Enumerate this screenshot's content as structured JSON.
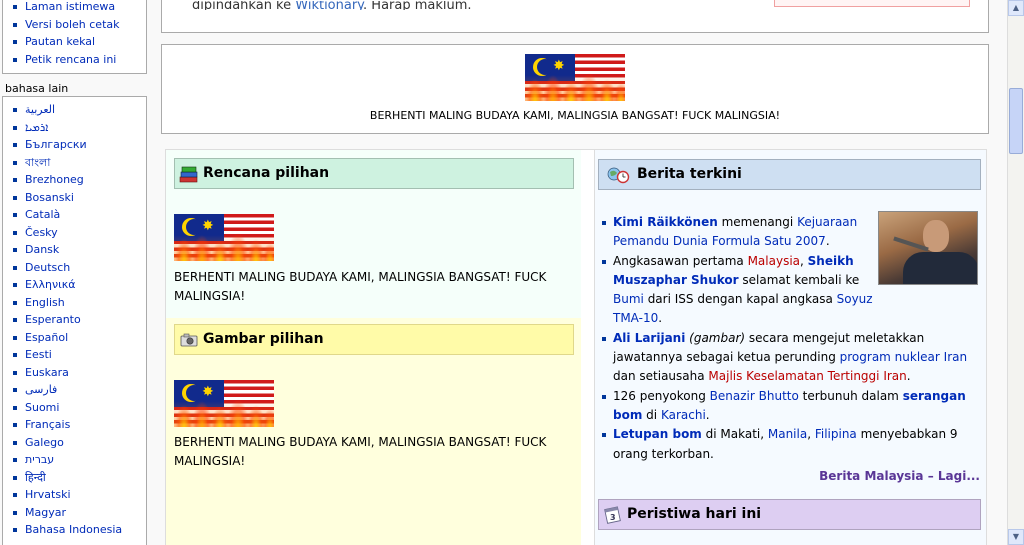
{
  "sidebar": {
    "tools": [
      "Laman istimewa",
      "Versi boleh cetak",
      "Pautan kekal",
      "Petik rencana ini"
    ],
    "lang_heading": "bahasa lain",
    "languages": [
      "العربية",
      "ܐܪܡܝܐ",
      "Български",
      "বাংলা",
      "Brezhoneg",
      "Bosanski",
      "Català",
      "Česky",
      "Dansk",
      "Deutsch",
      "Ελληνικά",
      "English",
      "Esperanto",
      "Español",
      "Eesti",
      "Euskara",
      "فارسی",
      "Suomi",
      "Français",
      "Galego",
      "עברית",
      "हिन्दी",
      "Hrvatski",
      "Magyar",
      "Bahasa Indonesia"
    ]
  },
  "top": {
    "text_before": "dipindahkan ke ",
    "link": "Wiktionary",
    "text_after": ". Harap maklum."
  },
  "banner": {
    "caption": "BERHENTI MALING BUDAYA KAMI, MALINGSIA BANGSAT! FUCK MALINGSIA!"
  },
  "featured": {
    "title": "Rencana pilihan",
    "text": "BERHENTI MALING BUDAYA KAMI, MALINGSIA BANGSAT! FUCK MALINGSIA!"
  },
  "picture": {
    "title": "Gambar pilihan",
    "text": "BERHENTI MALING BUDAYA KAMI, MALINGSIA BANGSAT! FUCK MALINGSIA!"
  },
  "news": {
    "title": "Berita terkini",
    "items": [
      {
        "b1": "Kimi Räikkönen",
        "t1": " memenangi ",
        "l1": "Kejuaraan Pemandu Dunia Formula Satu 2007",
        "t2": "."
      },
      {
        "t0": "Angkasawan pertama ",
        "n1": "Malaysia",
        "t1": ", ",
        "b1": "Sheikh Muszaphar Shukor",
        "t2": " selamat kembali ke ",
        "l1": "Bumi",
        "t3": " dari ISS dengan kapal angkasa ",
        "l2": "Soyuz TMA-10",
        "t4": "."
      },
      {
        "b1": "Ali Larijani",
        "i1": " (gambar)",
        "t1": " secara mengejut meletakkan jawatannya sebagai ketua perunding ",
        "l1": "program nuklear Iran",
        "t2": " dan setiausaha ",
        "n1": "Majlis Keselamatan Tertinggi Iran",
        "t3": "."
      },
      {
        "t0": "126 penyokong ",
        "l1": "Benazir Bhutto",
        "t1": " terbunuh dalam ",
        "b1": "serangan bom",
        "t2": " di ",
        "l2": "Karachi",
        "t3": "."
      },
      {
        "b1": "Letupan bom",
        "t1": " di Makati, ",
        "l1": "Manila",
        "t2": ", ",
        "l2": "Filipina",
        "t3": " menyebabkan 9 orang terkorban."
      }
    ],
    "more": "Berita Malaysia – Lagi..."
  },
  "events": {
    "title": "Peristiwa hari ini"
  },
  "icons": {
    "featured": "books-icon",
    "picture": "camera-icon",
    "news": "globe-clock-icon",
    "events": "calendar-icon"
  }
}
